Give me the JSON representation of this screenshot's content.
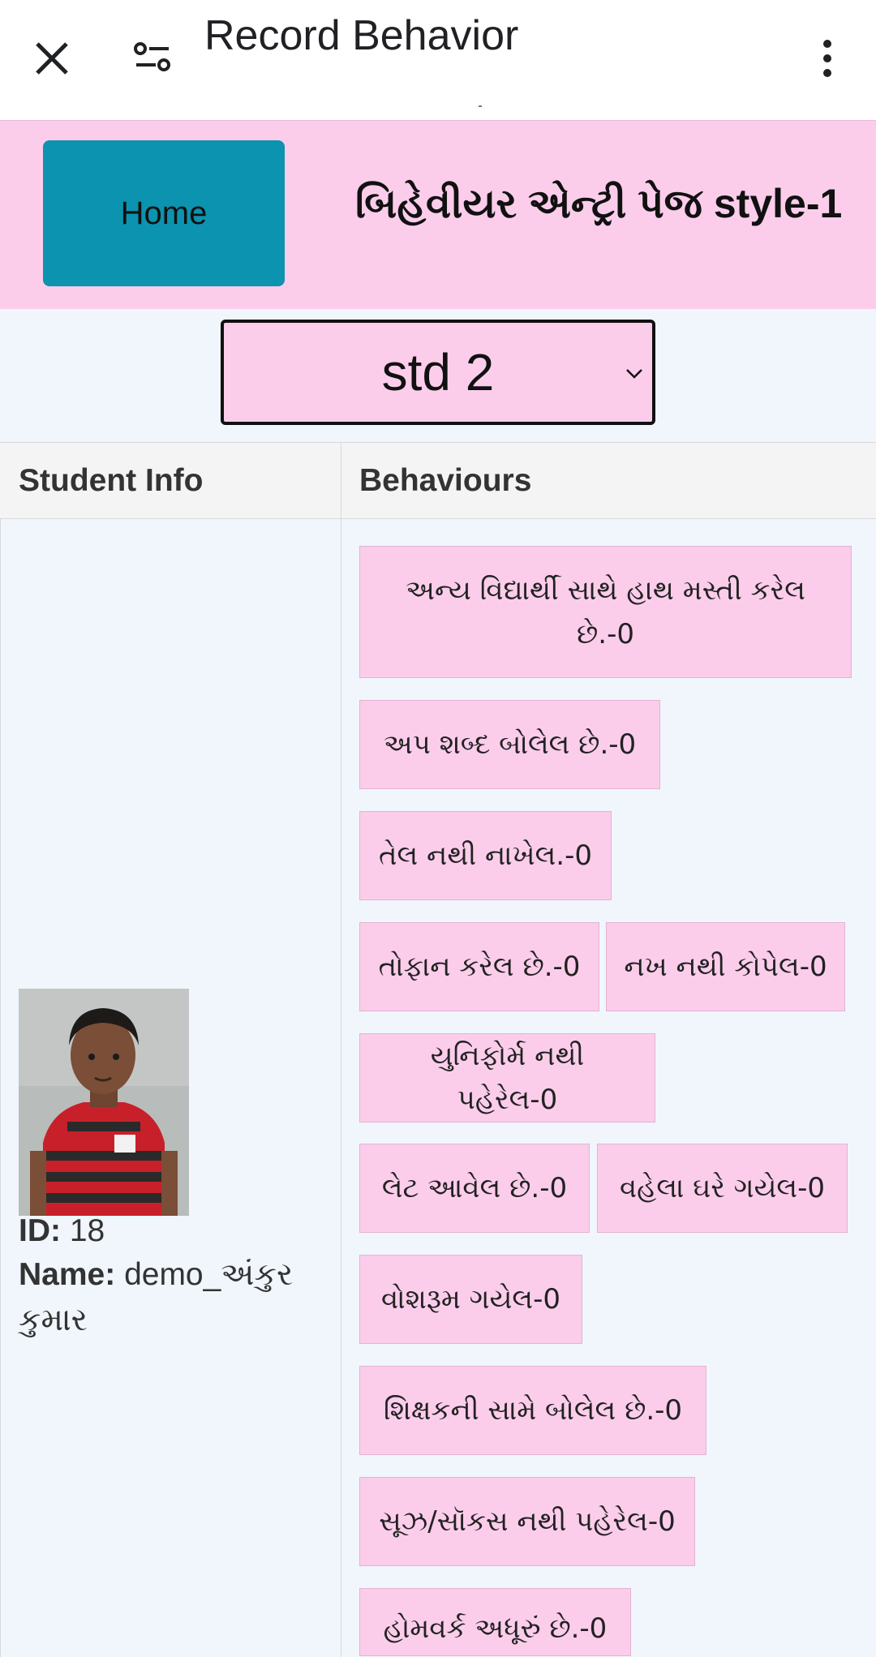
{
  "appbar": {
    "title": "Record Behavior"
  },
  "header": {
    "home_label": "Home",
    "page_heading": "બિહેવીયર એન્ટ્રી પેજ style-1"
  },
  "std_select": {
    "value": "std 2"
  },
  "table": {
    "col_student_info": "Student Info",
    "col_behaviours": "Behaviours"
  },
  "student": {
    "id_label": "ID:",
    "id_value": "18",
    "name_label": "Name:",
    "name_value": "demo_અંકુર કુમાર"
  },
  "behaviours": [
    "અન્ય વિદ્યાર્થી સાથે હાથ મસ્તી કરેલ છે.-0",
    "અપ શબ્દ બોલેલ છે.-0",
    "તેલ નથી નાખેલ.-0",
    "તોફાન કરેલ છે.-0",
    "નખ નથી કોપેલ-0",
    "યુનિફોર્મ નથી પહેરેલ-0",
    "લેટ આવેલ છે.-0",
    "વહેલા ઘરે ગયેલ-0",
    "વોશરૂમ ગયેલ-0",
    "શિક્ષકની સામે બોલેલ છે.-0",
    "સૂઝ/સૉકસ નથી પહેરેલ-0",
    "હોમવર્ક અધૂરું છે.-0"
  ]
}
